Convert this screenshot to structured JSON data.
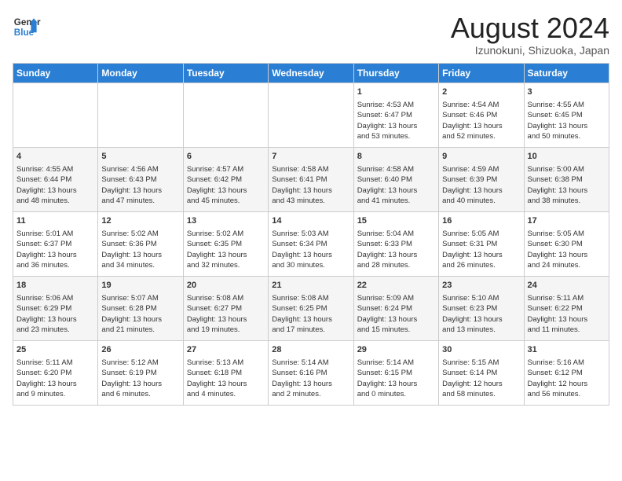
{
  "header": {
    "logo_line1": "General",
    "logo_line2": "Blue",
    "month_year": "August 2024",
    "location": "Izunokuni, Shizuoka, Japan"
  },
  "weekdays": [
    "Sunday",
    "Monday",
    "Tuesday",
    "Wednesday",
    "Thursday",
    "Friday",
    "Saturday"
  ],
  "weeks": [
    [
      {
        "day": "",
        "info": ""
      },
      {
        "day": "",
        "info": ""
      },
      {
        "day": "",
        "info": ""
      },
      {
        "day": "",
        "info": ""
      },
      {
        "day": "1",
        "info": "Sunrise: 4:53 AM\nSunset: 6:47 PM\nDaylight: 13 hours\nand 53 minutes."
      },
      {
        "day": "2",
        "info": "Sunrise: 4:54 AM\nSunset: 6:46 PM\nDaylight: 13 hours\nand 52 minutes."
      },
      {
        "day": "3",
        "info": "Sunrise: 4:55 AM\nSunset: 6:45 PM\nDaylight: 13 hours\nand 50 minutes."
      }
    ],
    [
      {
        "day": "4",
        "info": "Sunrise: 4:55 AM\nSunset: 6:44 PM\nDaylight: 13 hours\nand 48 minutes."
      },
      {
        "day": "5",
        "info": "Sunrise: 4:56 AM\nSunset: 6:43 PM\nDaylight: 13 hours\nand 47 minutes."
      },
      {
        "day": "6",
        "info": "Sunrise: 4:57 AM\nSunset: 6:42 PM\nDaylight: 13 hours\nand 45 minutes."
      },
      {
        "day": "7",
        "info": "Sunrise: 4:58 AM\nSunset: 6:41 PM\nDaylight: 13 hours\nand 43 minutes."
      },
      {
        "day": "8",
        "info": "Sunrise: 4:58 AM\nSunset: 6:40 PM\nDaylight: 13 hours\nand 41 minutes."
      },
      {
        "day": "9",
        "info": "Sunrise: 4:59 AM\nSunset: 6:39 PM\nDaylight: 13 hours\nand 40 minutes."
      },
      {
        "day": "10",
        "info": "Sunrise: 5:00 AM\nSunset: 6:38 PM\nDaylight: 13 hours\nand 38 minutes."
      }
    ],
    [
      {
        "day": "11",
        "info": "Sunrise: 5:01 AM\nSunset: 6:37 PM\nDaylight: 13 hours\nand 36 minutes."
      },
      {
        "day": "12",
        "info": "Sunrise: 5:02 AM\nSunset: 6:36 PM\nDaylight: 13 hours\nand 34 minutes."
      },
      {
        "day": "13",
        "info": "Sunrise: 5:02 AM\nSunset: 6:35 PM\nDaylight: 13 hours\nand 32 minutes."
      },
      {
        "day": "14",
        "info": "Sunrise: 5:03 AM\nSunset: 6:34 PM\nDaylight: 13 hours\nand 30 minutes."
      },
      {
        "day": "15",
        "info": "Sunrise: 5:04 AM\nSunset: 6:33 PM\nDaylight: 13 hours\nand 28 minutes."
      },
      {
        "day": "16",
        "info": "Sunrise: 5:05 AM\nSunset: 6:31 PM\nDaylight: 13 hours\nand 26 minutes."
      },
      {
        "day": "17",
        "info": "Sunrise: 5:05 AM\nSunset: 6:30 PM\nDaylight: 13 hours\nand 24 minutes."
      }
    ],
    [
      {
        "day": "18",
        "info": "Sunrise: 5:06 AM\nSunset: 6:29 PM\nDaylight: 13 hours\nand 23 minutes."
      },
      {
        "day": "19",
        "info": "Sunrise: 5:07 AM\nSunset: 6:28 PM\nDaylight: 13 hours\nand 21 minutes."
      },
      {
        "day": "20",
        "info": "Sunrise: 5:08 AM\nSunset: 6:27 PM\nDaylight: 13 hours\nand 19 minutes."
      },
      {
        "day": "21",
        "info": "Sunrise: 5:08 AM\nSunset: 6:25 PM\nDaylight: 13 hours\nand 17 minutes."
      },
      {
        "day": "22",
        "info": "Sunrise: 5:09 AM\nSunset: 6:24 PM\nDaylight: 13 hours\nand 15 minutes."
      },
      {
        "day": "23",
        "info": "Sunrise: 5:10 AM\nSunset: 6:23 PM\nDaylight: 13 hours\nand 13 minutes."
      },
      {
        "day": "24",
        "info": "Sunrise: 5:11 AM\nSunset: 6:22 PM\nDaylight: 13 hours\nand 11 minutes."
      }
    ],
    [
      {
        "day": "25",
        "info": "Sunrise: 5:11 AM\nSunset: 6:20 PM\nDaylight: 13 hours\nand 9 minutes."
      },
      {
        "day": "26",
        "info": "Sunrise: 5:12 AM\nSunset: 6:19 PM\nDaylight: 13 hours\nand 6 minutes."
      },
      {
        "day": "27",
        "info": "Sunrise: 5:13 AM\nSunset: 6:18 PM\nDaylight: 13 hours\nand 4 minutes."
      },
      {
        "day": "28",
        "info": "Sunrise: 5:14 AM\nSunset: 6:16 PM\nDaylight: 13 hours\nand 2 minutes."
      },
      {
        "day": "29",
        "info": "Sunrise: 5:14 AM\nSunset: 6:15 PM\nDaylight: 13 hours\nand 0 minutes."
      },
      {
        "day": "30",
        "info": "Sunrise: 5:15 AM\nSunset: 6:14 PM\nDaylight: 12 hours\nand 58 minutes."
      },
      {
        "day": "31",
        "info": "Sunrise: 5:16 AM\nSunset: 6:12 PM\nDaylight: 12 hours\nand 56 minutes."
      }
    ]
  ]
}
